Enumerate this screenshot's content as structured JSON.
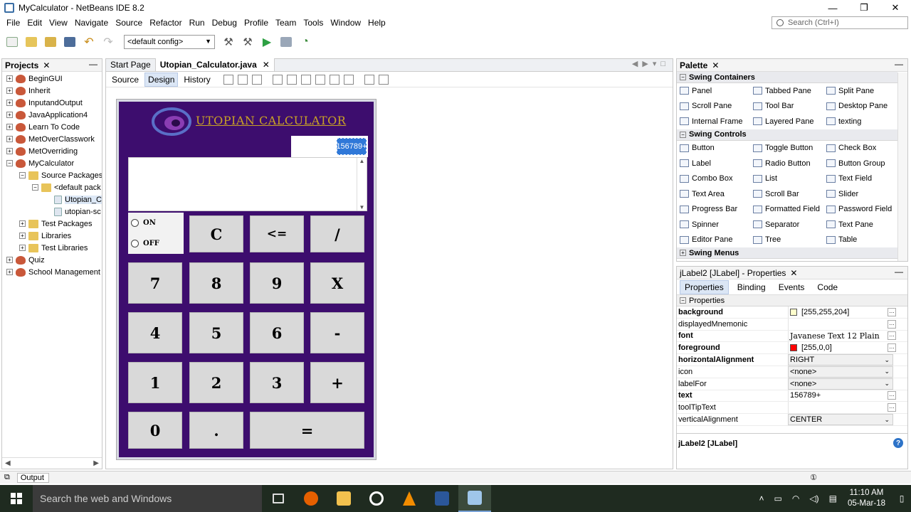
{
  "window": {
    "title": "MyCalculator - NetBeans IDE 8.2",
    "controls": {
      "minimize": "—",
      "maximize": "❐",
      "close": "✕"
    }
  },
  "menu": [
    "File",
    "Edit",
    "View",
    "Navigate",
    "Source",
    "Refactor",
    "Run",
    "Debug",
    "Profile",
    "Team",
    "Tools",
    "Window",
    "Help"
  ],
  "search": {
    "placeholder": "Search (Ctrl+I)"
  },
  "toolbar": {
    "config": "<default config>"
  },
  "projects": {
    "title": "Projects",
    "close": "✕",
    "minimize": "—",
    "items": [
      {
        "label": "BeginGUI",
        "indent": 0,
        "toggle": "+",
        "icon": "project"
      },
      {
        "label": "Inherit",
        "indent": 0,
        "toggle": "+",
        "icon": "project"
      },
      {
        "label": "InputandOutput",
        "indent": 0,
        "toggle": "+",
        "icon": "project"
      },
      {
        "label": "JavaApplication4",
        "indent": 0,
        "toggle": "+",
        "icon": "project"
      },
      {
        "label": "Learn To Code",
        "indent": 0,
        "toggle": "+",
        "icon": "project"
      },
      {
        "label": "MetOverClasswork",
        "indent": 0,
        "toggle": "+",
        "icon": "project"
      },
      {
        "label": "MetOverriding",
        "indent": 0,
        "toggle": "+",
        "icon": "project"
      },
      {
        "label": "MyCalculator",
        "indent": 0,
        "toggle": "−",
        "icon": "project"
      },
      {
        "label": "Source Packages",
        "indent": 1,
        "toggle": "−",
        "icon": "folder"
      },
      {
        "label": "<default pack",
        "indent": 2,
        "toggle": "−",
        "icon": "folder"
      },
      {
        "label": "Utopian_C",
        "indent": 3,
        "toggle": "",
        "icon": "file",
        "selected": true
      },
      {
        "label": "utopian-sc",
        "indent": 3,
        "toggle": "",
        "icon": "file"
      },
      {
        "label": "Test Packages",
        "indent": 1,
        "toggle": "+",
        "icon": "folder"
      },
      {
        "label": "Libraries",
        "indent": 1,
        "toggle": "+",
        "icon": "folder"
      },
      {
        "label": "Test Libraries",
        "indent": 1,
        "toggle": "+",
        "icon": "folder"
      },
      {
        "label": "Quiz",
        "indent": 0,
        "toggle": "+",
        "icon": "project"
      },
      {
        "label": "School Management S",
        "indent": 0,
        "toggle": "+",
        "icon": "project"
      }
    ]
  },
  "editor": {
    "tabs": [
      {
        "label": "Start Page",
        "active": false
      },
      {
        "label": "Utopian_Calculator.java",
        "active": true,
        "close": "✕"
      }
    ],
    "views": [
      "Source",
      "Design",
      "History"
    ],
    "active_view": "Design"
  },
  "calculator": {
    "title": "UTOPIAN CALCULATOR",
    "display": "156789+",
    "on_label": "ON",
    "off_label": "OFF",
    "keys": {
      "clear": "C",
      "back": "<=",
      "divide": "/",
      "k7": "7",
      "k8": "8",
      "k9": "9",
      "multiply": "X",
      "k4": "4",
      "k5": "5",
      "k6": "6",
      "minus": "-",
      "k1": "1",
      "k2": "2",
      "k3": "3",
      "plus": "+",
      "k0": "0",
      "dot": ".",
      "equals": "="
    }
  },
  "palette": {
    "title": "Palette",
    "close": "✕",
    "minimize": "—",
    "sections": [
      {
        "title": "Swing Containers",
        "toggle": "−",
        "items": [
          "Panel",
          "Tabbed Pane",
          "Split Pane",
          "Scroll Pane",
          "Tool Bar",
          "Desktop Pane",
          "Internal Frame",
          "Layered Pane",
          "texting"
        ]
      },
      {
        "title": "Swing Controls",
        "toggle": "−",
        "items": [
          "Button",
          "Toggle Button",
          "Check Box",
          "Label",
          "Radio Button",
          "Button Group",
          "Combo Box",
          "List",
          "Text Field",
          "Text Area",
          "Scroll Bar",
          "Slider",
          "Progress Bar",
          "Formatted Field",
          "Password Field",
          "Spinner",
          "Separator",
          "Text Pane",
          "Editor Pane",
          "Tree",
          "Table"
        ]
      },
      {
        "title": "Swing Menus",
        "toggle": "+",
        "items": []
      }
    ]
  },
  "properties": {
    "title": "jLabel2 [JLabel] - Properties",
    "close": "✕",
    "minimize": "—",
    "tabs": [
      "Properties",
      "Binding",
      "Events",
      "Code"
    ],
    "active_tab": "Properties",
    "section": "Properties",
    "section_toggle": "−",
    "rows": [
      {
        "name": "background",
        "value": "[255,255,204]",
        "bold": true,
        "swatch": "#ffffcc",
        "kind": "text"
      },
      {
        "name": "displayedMnemonic",
        "value": "",
        "bold": false,
        "kind": "text"
      },
      {
        "name": "font",
        "value": "Javanese Text 12 Plain",
        "bold": true,
        "kind": "text"
      },
      {
        "name": "foreground",
        "value": "[255,0,0]",
        "bold": true,
        "swatch": "#ff0000",
        "kind": "text"
      },
      {
        "name": "horizontalAlignment",
        "value": "RIGHT",
        "bold": true,
        "kind": "combo"
      },
      {
        "name": "icon",
        "value": "<none>",
        "bold": false,
        "kind": "combo"
      },
      {
        "name": "labelFor",
        "value": "<none>",
        "bold": false,
        "kind": "combo"
      },
      {
        "name": "text",
        "value": "156789+",
        "bold": true,
        "kind": "text"
      },
      {
        "name": "toolTipText",
        "value": "",
        "bold": false,
        "kind": "text"
      },
      {
        "name": "verticalAlignment",
        "value": "CENTER",
        "bold": false,
        "kind": "combo"
      }
    ],
    "footer": "jLabel2 [JLabel]",
    "help": "?"
  },
  "status": {
    "output": "Output"
  },
  "taskbar": {
    "search": "Search the web and Windows",
    "apps": [
      "task-view",
      "firefox",
      "file-explorer",
      "media-player",
      "vlc",
      "word",
      "netbeans"
    ],
    "time": "11:10 AM",
    "date": "05-Mar-18"
  },
  "colors": {
    "calc_bg": "#3d0d6e",
    "calc_title": "#c9a226",
    "display_select": "#2f78d8",
    "key_bg": "#d9d9d9",
    "taskbar_bg": "#1f2b20"
  }
}
